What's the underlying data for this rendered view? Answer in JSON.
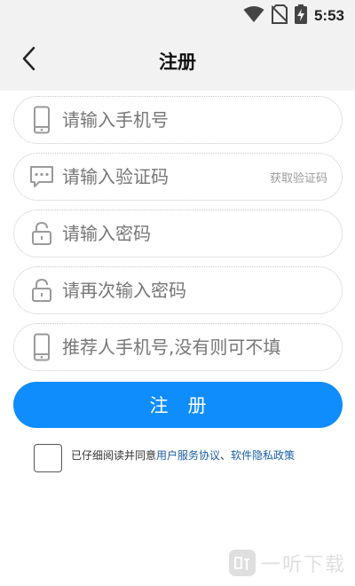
{
  "status_bar": {
    "time": "5:53",
    "icons": [
      "wifi-icon",
      "no-sim-icon",
      "battery-charging-icon"
    ]
  },
  "nav": {
    "back_icon": "chevron-left-icon",
    "title": "注册"
  },
  "form": {
    "phone": {
      "placeholder": "请输入手机号",
      "icon": "phone-icon"
    },
    "code": {
      "placeholder": "请输入验证码",
      "icon": "message-icon",
      "action_label": "获取验证码"
    },
    "password": {
      "placeholder": "请输入密码",
      "icon": "lock-icon"
    },
    "password_confirm": {
      "placeholder": "请再次输入密码",
      "icon": "lock-icon"
    },
    "referrer": {
      "placeholder": "推荐人手机号,没有则可不填",
      "icon": "phone-icon"
    }
  },
  "register_button": "注册",
  "agreement": {
    "prefix": "已仔细阅读并同意",
    "link1": "用户服务协议",
    "separator": "、",
    "link2": "软件隐私政策"
  },
  "watermark": {
    "text": "一听下载"
  },
  "colors": {
    "accent": "#0f8dfc",
    "link": "#1a5fa8",
    "header_bg": "#f2f2f2"
  }
}
